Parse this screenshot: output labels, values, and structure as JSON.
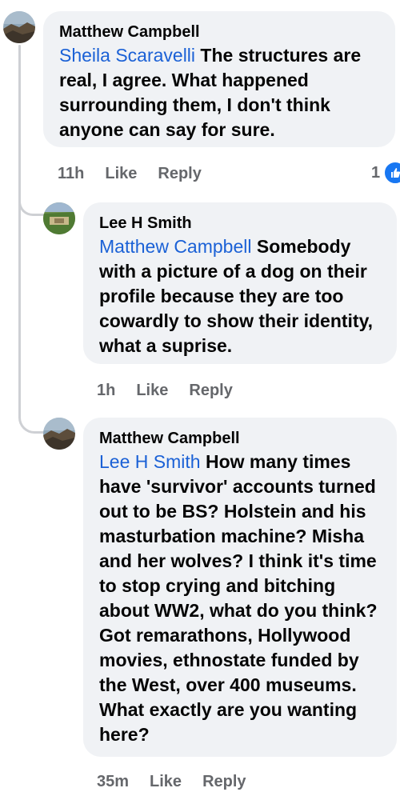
{
  "comments": [
    {
      "author": "Matthew Campbell",
      "mention": "Sheila Scaravelli",
      "text": " The structures are real, I agree. What happened surrounding them, I don't think anyone can say for sure.",
      "time": "11h",
      "like_label": "Like",
      "reply_label": "Reply",
      "reaction_count": "1",
      "reaction_icon": "like-icon"
    },
    {
      "author": "Lee H Smith",
      "mention": "Matthew Campbell",
      "text": " Somebody with a picture of a dog on their profile because they are too cowardly to show their identity, what a suprise.",
      "time": "1h",
      "like_label": "Like",
      "reply_label": "Reply"
    },
    {
      "author": "Matthew Campbell",
      "mention": "Lee H Smith",
      "text": " How many times have 'survivor' accounts turned out to be BS? Holstein and his masturbation machine? Misha and her wolves? I think it's time to stop crying and bitching about WW2, what do you think? Got remarathons, Hollywood movies, ethnostate funded by the West, over 400 museums. What exactly are you wanting here?",
      "time": "35m",
      "like_label": "Like",
      "reply_label": "Reply"
    }
  ],
  "colors": {
    "mention": "#1b61d6",
    "bubble": "#f0f2f5",
    "meta": "#65676b",
    "like_blue": "#1877f2"
  }
}
